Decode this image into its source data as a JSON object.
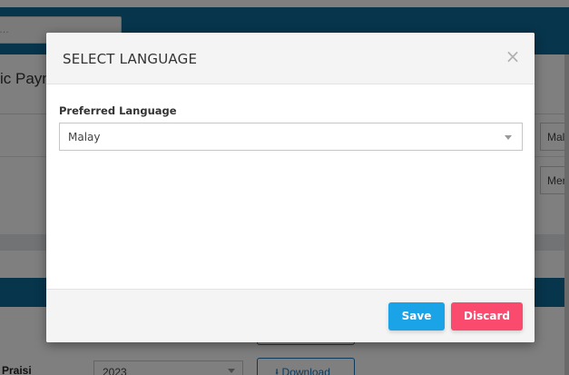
{
  "background": {
    "search_placeholder": "…",
    "page_title": "ic Payn",
    "select_1_value": "Mala",
    "select_2_value": "Merc",
    "row_label": "Praisi",
    "year_value": "2023",
    "download_label": "⭳ Download"
  },
  "modal": {
    "title": "SELECT LANGUAGE",
    "close_glyph": "×",
    "field_label": "Preferred Language",
    "selected_language": "Malay",
    "save_label": "Save",
    "discard_label": "Discard"
  },
  "colors": {
    "header_blue": "#0f6b99",
    "save": "#1aa3e6",
    "discard": "#fa4a6d"
  }
}
